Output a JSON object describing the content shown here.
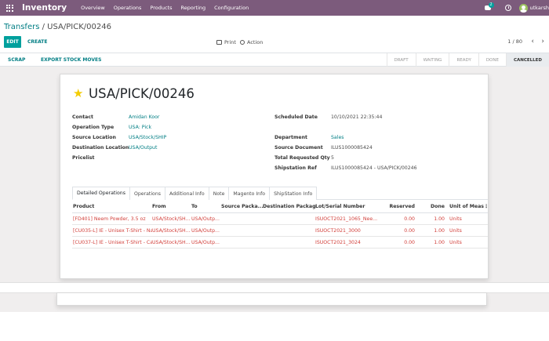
{
  "app": {
    "name": "Inventory",
    "menu": [
      "Overview",
      "Operations",
      "Products",
      "Reporting",
      "Configuration"
    ],
    "messages_badge": "2",
    "user": "utkarsh"
  },
  "breadcrumb": {
    "parent": "Transfers",
    "separator": "/",
    "current": "USA/PICK/00246"
  },
  "toolbar": {
    "edit": "EDIT",
    "create": "CREATE",
    "print": "Print",
    "action": "Action"
  },
  "pager": {
    "value": "1 / 80",
    "prev": "‹",
    "next": "›"
  },
  "statusbar": {
    "buttons": [
      "SCRAP",
      "EXPORT STOCK MOVES"
    ],
    "stages": [
      {
        "label": "DRAFT",
        "active": false
      },
      {
        "label": "WAITING",
        "active": false
      },
      {
        "label": "READY",
        "active": false
      },
      {
        "label": "DONE",
        "active": false
      },
      {
        "label": "CANCELLED",
        "active": true
      }
    ]
  },
  "record": {
    "title": "USA/PICK/00246",
    "left_fields": [
      {
        "label": "Contact",
        "value": "Amidan Koor",
        "link": true
      },
      {
        "label": "Operation Type",
        "value": "USA: Pick",
        "link": true
      },
      {
        "label": "Source Location",
        "value": "USA/Stock/SHIP",
        "link": true
      },
      {
        "label": "Destination Location",
        "value": "USA/Output",
        "link": true
      },
      {
        "label": "Pricelist",
        "value": "",
        "link": false
      }
    ],
    "right_fields": [
      {
        "label": "Scheduled Date",
        "value": "10/10/2021 22:35:44",
        "link": false
      },
      {
        "label": "Department",
        "value": "Sales",
        "link": true
      },
      {
        "label": "Source Document",
        "value": "ILUS1000085424",
        "link": false
      },
      {
        "label": "Total Requested Qty",
        "value": "5",
        "link": false
      },
      {
        "label": "Shipstation Ref",
        "value": "ILUS1000085424 - USA/PICK/00246",
        "link": false
      }
    ]
  },
  "tabs": [
    "Detailed Operations",
    "Operations",
    "Additional Info",
    "Note",
    "Magento Info",
    "ShipStation Info"
  ],
  "table": {
    "headers": [
      "Product",
      "From",
      "To",
      "Source Packa...",
      "Destination Package",
      "Lot/Serial Number",
      "Reserved",
      "Done",
      "Unit of Measure",
      "⋮"
    ],
    "rows": [
      [
        "[FD401] Neem Powder, 3.5 oz",
        "USA/Stock/SH...",
        "USA/Outp...",
        "",
        "",
        "ISUOCT2021_1065_Nee...",
        "0.00",
        "1.00",
        "Units"
      ],
      [
        "[CU035-L] IE - Unisex T-Shirt - Nav...",
        "USA/Stock/SH...",
        "USA/Outp...",
        "",
        "",
        "ISUOCT2021_3000",
        "0.00",
        "1.00",
        "Units"
      ],
      [
        "[CU037-L] IE - Unisex T-Shirt - Car...",
        "USA/Stock/SH...",
        "USA/Outp...",
        "",
        "",
        "ISUOCT2021_3024",
        "0.00",
        "1.00",
        "Units"
      ]
    ]
  },
  "colors": {
    "navbar": "#7c5b7c",
    "accent": "#00a09d",
    "link": "#017e84",
    "cancelled_row": "#d23f3a",
    "star": "#f3cc00"
  }
}
